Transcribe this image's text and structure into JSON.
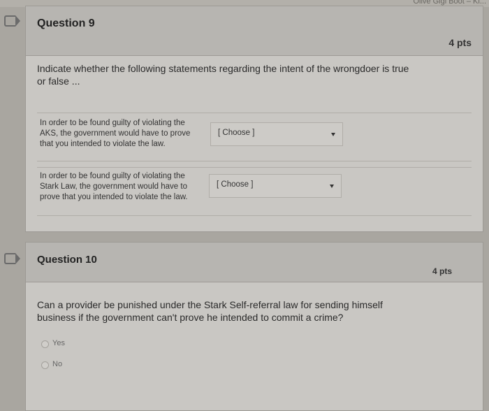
{
  "topbar": {
    "right_text": "Olive Gigi Boot – Kl..."
  },
  "question9": {
    "title": "Question 9",
    "points": "4 pts",
    "prompt_line1": "Indicate whether the following statements regarding the intent of the wrongdoer is true",
    "prompt_line2": "or false ...",
    "statements": [
      {
        "text_lines": [
          "In order to be found guilty of violating the",
          "AKS, the government would have to prove",
          "that you intended to violate the law."
        ],
        "select_value": "[ Choose ]"
      },
      {
        "text_lines": [
          "In order to be found guilty of violating the",
          "Stark Law, the government would have to",
          "prove that you intended to violate the law."
        ],
        "select_value": "[ Choose ]"
      }
    ]
  },
  "question10": {
    "title": "Question 10",
    "points": "4 pts",
    "prompt_line1": "Can a provider be punished under the Stark Self-referral law for sending himself",
    "prompt_line2": "business if the government can't prove he intended to commit a crime?",
    "options": [
      "Yes",
      "No"
    ]
  }
}
